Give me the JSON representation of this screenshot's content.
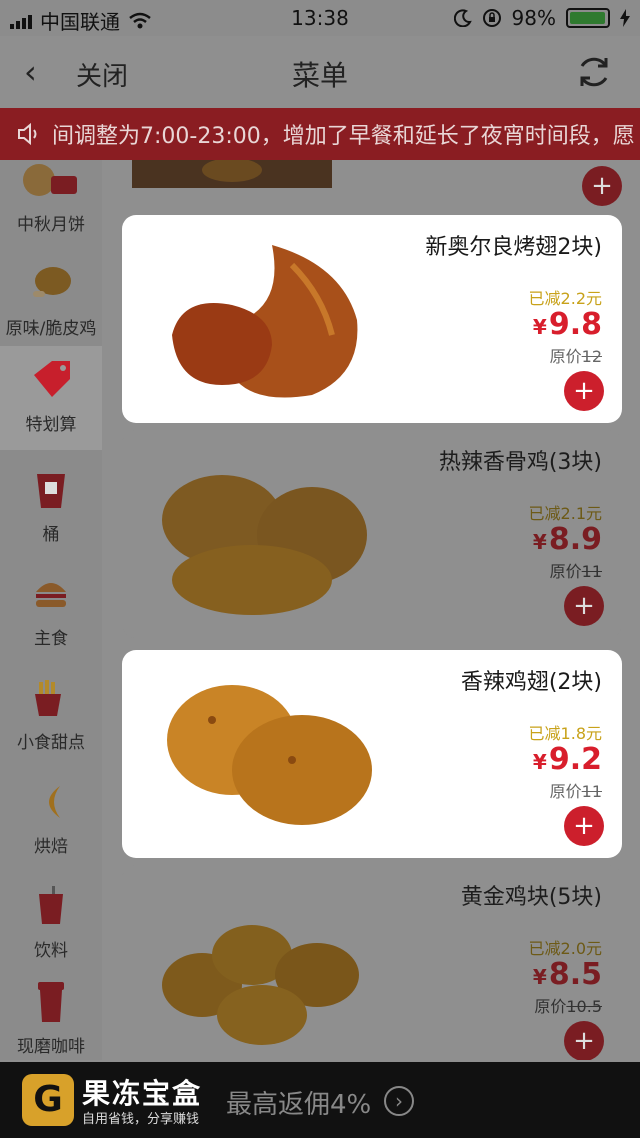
{
  "status": {
    "carrier": "中国联通",
    "time": "13:38",
    "battery": "98%"
  },
  "nav": {
    "back_icon": "‹",
    "close": "关闭",
    "title": "菜单"
  },
  "notice": {
    "text": "间调整为7:00-23:00，增加了早餐和延长了夜宵时间段，愿"
  },
  "sidebar": {
    "items": [
      {
        "label": "中秋月饼"
      },
      {
        "label": "原味/脆皮鸡"
      },
      {
        "label": "特划算"
      },
      {
        "label": "桶"
      },
      {
        "label": "主食"
      },
      {
        "label": "小食甜点"
      },
      {
        "label": "烘焙"
      },
      {
        "label": "饮料"
      },
      {
        "label": "现磨咖啡"
      }
    ]
  },
  "products": [
    {
      "name": "新奥尔良烤翅2块)",
      "discount": "已减2.2元",
      "yen": "¥",
      "price": "9.8",
      "orig_label": "原价",
      "orig": "12"
    },
    {
      "name": "热辣香骨鸡(3块)",
      "discount": "已减2.1元",
      "yen": "¥",
      "price": "8.9",
      "orig_label": "原价",
      "orig": "11"
    },
    {
      "name": "香辣鸡翅(2块)",
      "discount": "已减1.8元",
      "yen": "¥",
      "price": "9.2",
      "orig_label": "原价",
      "orig": "11"
    },
    {
      "name": "黄金鸡块(5块)",
      "discount": "已减2.0元",
      "yen": "¥",
      "price": "8.5",
      "orig_label": "原价",
      "orig": "10.5"
    }
  ],
  "add_label": "+",
  "footer": {
    "logo_letter": "G",
    "brand": "果冻宝盒",
    "slogan": "自用省钱，分享赚钱",
    "cashback": "最高返佣4%",
    "arrow": "›"
  },
  "colors": {
    "accent_red": "#d81e2c",
    "discount_gold": "#c8a21a"
  }
}
